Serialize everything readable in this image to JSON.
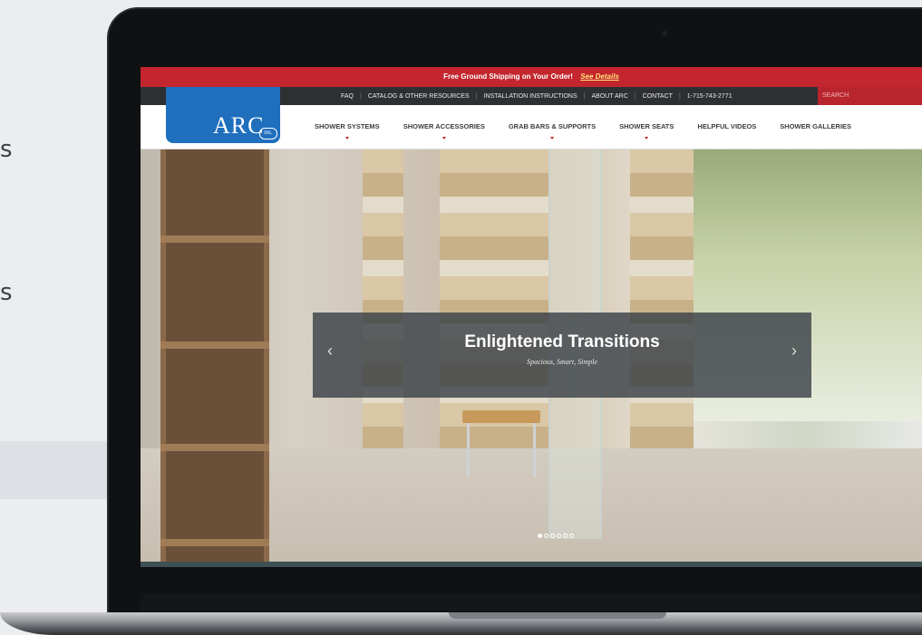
{
  "page_fragments": {
    "line1": "s",
    "line2": "s"
  },
  "site": {
    "promo": {
      "text": "Free Ground Shipping on Your Order!",
      "link": "See Details"
    },
    "utility_links": [
      "FAQ",
      "CATALOG & OTHER RESOURCES",
      "INSTALLATION INSTRUCTIONS",
      "ABOUT ARC",
      "CONTACT",
      "1-715-743-2771"
    ],
    "search_placeholder": "SEARCH",
    "logo": {
      "text": "ARC",
      "suffix": "inc."
    },
    "nav": [
      "SHOWER SYSTEMS",
      "SHOWER ACCESSORIES",
      "GRAB BARS & SUPPORTS",
      "SHOWER SEATS",
      "HELPFUL VIDEOS",
      "SHOWER GALLERIES"
    ],
    "hero": {
      "title": "Enlightened Transitions",
      "subtitle": "Spacious, Smart, Simple",
      "prev_glyph": "‹",
      "next_glyph": "›",
      "slide_count": 6,
      "active_slide": 1
    }
  },
  "colors": {
    "brand_red": "#c3262e",
    "brand_blue": "#1f6fbd",
    "utility_bar": "#2d2f33"
  }
}
